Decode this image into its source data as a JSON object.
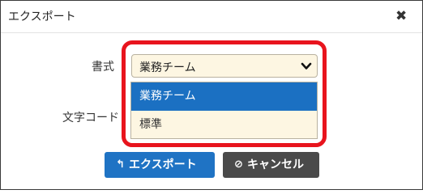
{
  "dialog": {
    "title": "エクスポート",
    "close_symbol": "✖"
  },
  "form": {
    "format_label": "書式",
    "charset_label": "文字コード",
    "format_select": {
      "selected": "業務チーム",
      "icon": "chevron-down-icon",
      "options": [
        "業務チーム",
        "標準"
      ],
      "highlighted_option": "業務チーム"
    }
  },
  "buttons": {
    "export": {
      "label": "エクスポート",
      "icon": "return-arrow-icon",
      "icon_glyph": "↰"
    },
    "cancel": {
      "label": "キャンセル",
      "icon": "ban-icon",
      "icon_glyph": "⊘"
    }
  },
  "colors": {
    "highlight_border": "#e8141d",
    "selected_option": "#1b70c2",
    "export_button": "#1f73c4",
    "cancel_button": "#4a4a4a",
    "field_background": "#fdf6e2"
  }
}
